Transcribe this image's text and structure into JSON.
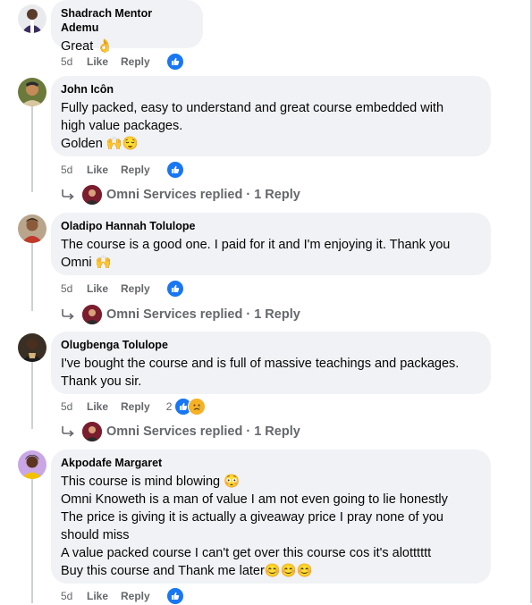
{
  "comments": [
    {
      "author": "Shadrach Mentor Ademu",
      "text": "Great 👌",
      "time": "5d",
      "like": "Like",
      "reply": "Reply",
      "reactions": {
        "count": "",
        "types": [
          "like"
        ]
      }
    },
    {
      "author": "John Icôn",
      "text": "Fully packed, easy to understand and great course embedded with\nhigh value packages.\nGolden 🙌😌",
      "time": "5d",
      "like": "Like",
      "reply": "Reply",
      "reactions": {
        "count": "",
        "types": [
          "like"
        ]
      },
      "replies": "Omni Services replied · 1 Reply"
    },
    {
      "author": "Oladipo Hannah Tolulope",
      "text": "The course is a good one. I paid for it and I'm enjoying it. Thank you\nOmni 🙌",
      "time": "5d",
      "like": "Like",
      "reply": "Reply",
      "reactions": {
        "count": "",
        "types": [
          "like"
        ]
      },
      "replies": "Omni Services replied · 1 Reply"
    },
    {
      "author": "Olugbenga Tolulope",
      "text": "I've bought the course and is full of massive teachings and packages.\nThank you sir.",
      "time": "5d",
      "like": "Like",
      "reply": "Reply",
      "reactions": {
        "count": "2",
        "types": [
          "like",
          "sad"
        ]
      },
      "replies": "Omni Services replied · 1 Reply"
    },
    {
      "author": "Akpodafe Margaret",
      "text": "This course is mind blowing 😳\nOmni Knoweth is a man of value I am not even going to lie honestly\nThe price is giving it is actually a giveaway price I pray none of you\nshould miss\nA value packed course I can't get over this course cos it's alotttttt\nBuy this course and Thank me later😊😊😊",
      "time": "5d",
      "like": "Like",
      "reply": "Reply",
      "reactions": {
        "count": "",
        "types": [
          "like"
        ]
      }
    }
  ],
  "icons": {
    "like": "like-thumb-icon",
    "sad": "sad-face-icon",
    "reply_arrow": "reply-arrow-icon"
  },
  "colors": {
    "bubble": "#f0f2f5",
    "like_blue": "#1877f2",
    "muted": "#65676b"
  }
}
